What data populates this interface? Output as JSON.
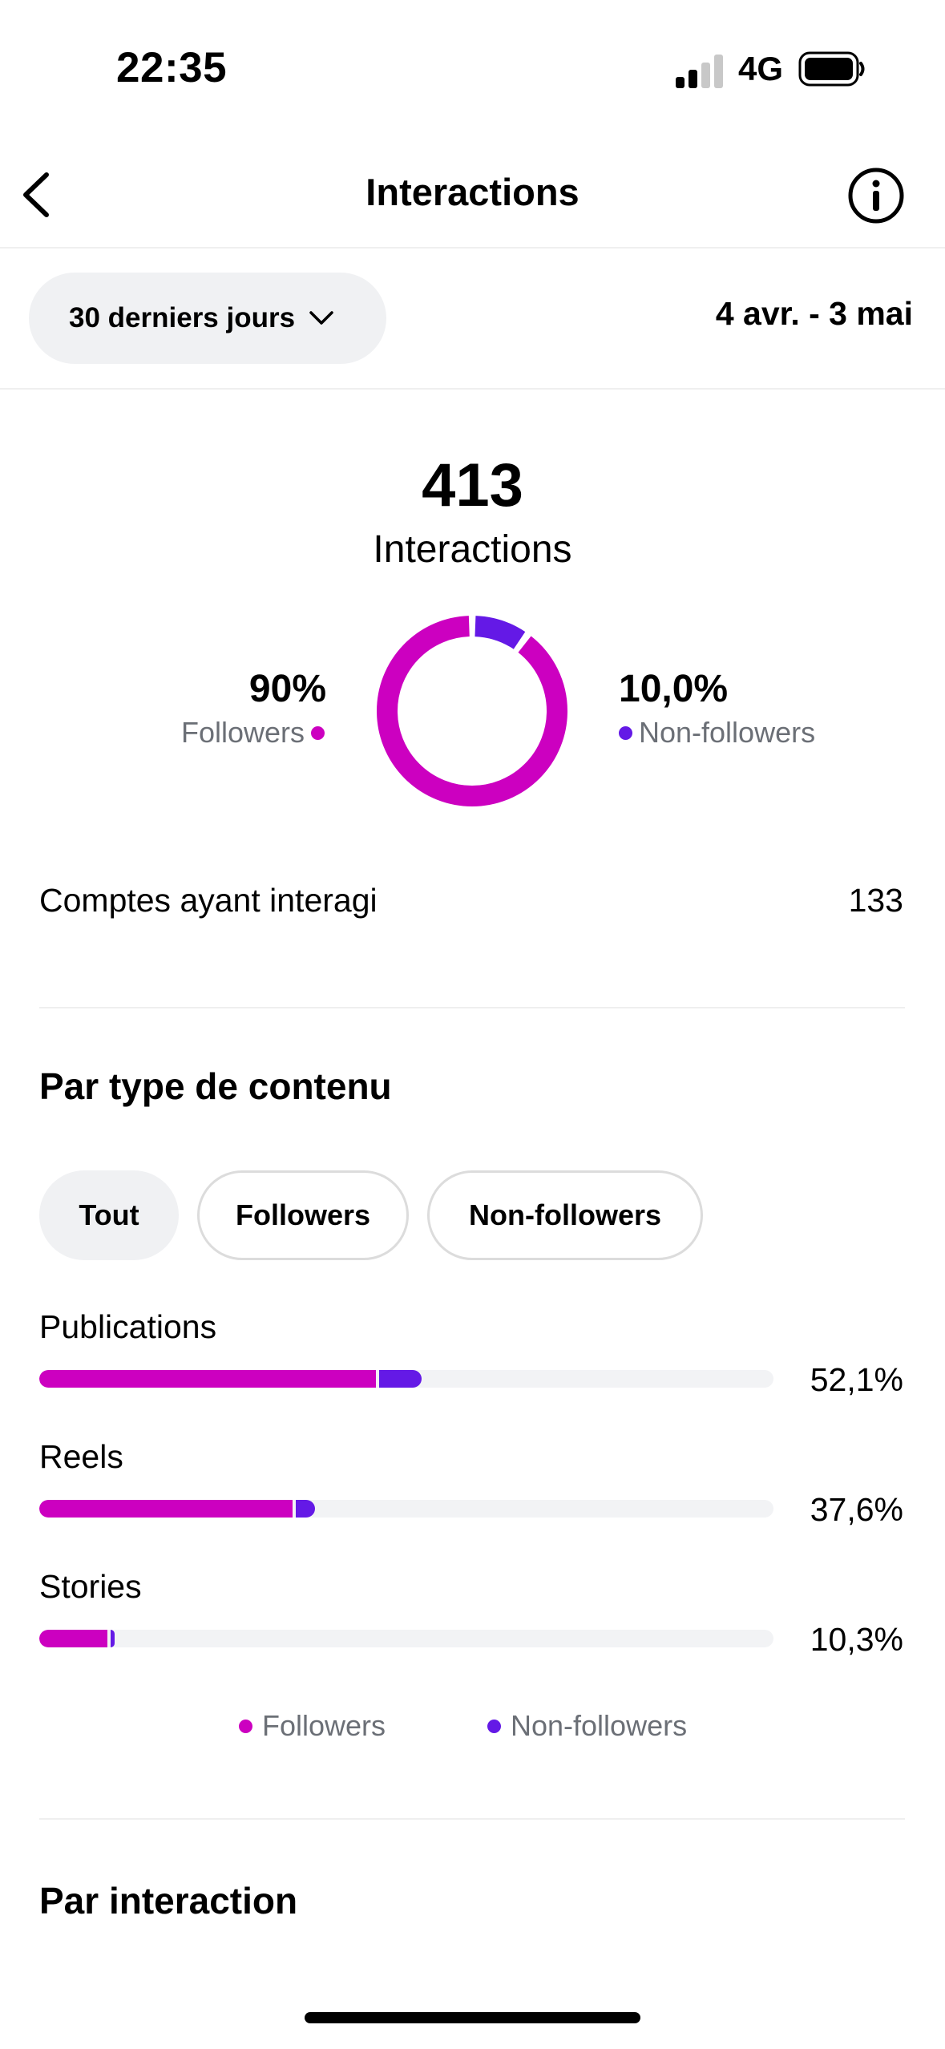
{
  "status_bar": {
    "time": "22:35",
    "network": "4G",
    "icons": [
      "signal-icon",
      "battery-icon"
    ]
  },
  "nav": {
    "title": "Interactions",
    "icons": [
      "back-chevron-icon",
      "info-icon"
    ]
  },
  "range": {
    "selector_label": "30 derniers jours",
    "dates": "4 avr. - 3 mai"
  },
  "summary": {
    "total": "413",
    "total_label": "Interactions",
    "followers_pct": "90%",
    "followers_label": "Followers",
    "nonfollowers_pct": "10,0%",
    "nonfollowers_label": "Non-followers",
    "followers_fraction": 0.9,
    "nonfollowers_fraction": 0.1
  },
  "accounts": {
    "label": "Comptes ayant interagi",
    "value": "133"
  },
  "by_content": {
    "title": "Par type de contenu",
    "filters": [
      {
        "label": "Tout",
        "selected": true
      },
      {
        "label": "Followers",
        "selected": false
      },
      {
        "label": "Non-followers",
        "selected": false
      }
    ],
    "rows": [
      {
        "label": "Publications",
        "pct": "52,1%",
        "total": 52.1,
        "followers": 45.8,
        "nonfollowers": 6.3
      },
      {
        "label": "Reels",
        "pct": "37,6%",
        "total": 37.6,
        "followers": 34.5,
        "nonfollowers": 3.1
      },
      {
        "label": "Stories",
        "pct": "10,3%",
        "total": 10.3,
        "followers": 9.3,
        "nonfollowers": 1.0
      }
    ],
    "legend": {
      "followers": "Followers",
      "nonfollowers": "Non-followers"
    }
  },
  "by_interaction": {
    "title": "Par interaction"
  },
  "colors": {
    "followers": "#cc00c0",
    "nonfollowers": "#6419e6",
    "track": "#f2f3f5",
    "chip_selected_bg": "#f0f1f3",
    "muted_text": "#6b6f76"
  }
}
